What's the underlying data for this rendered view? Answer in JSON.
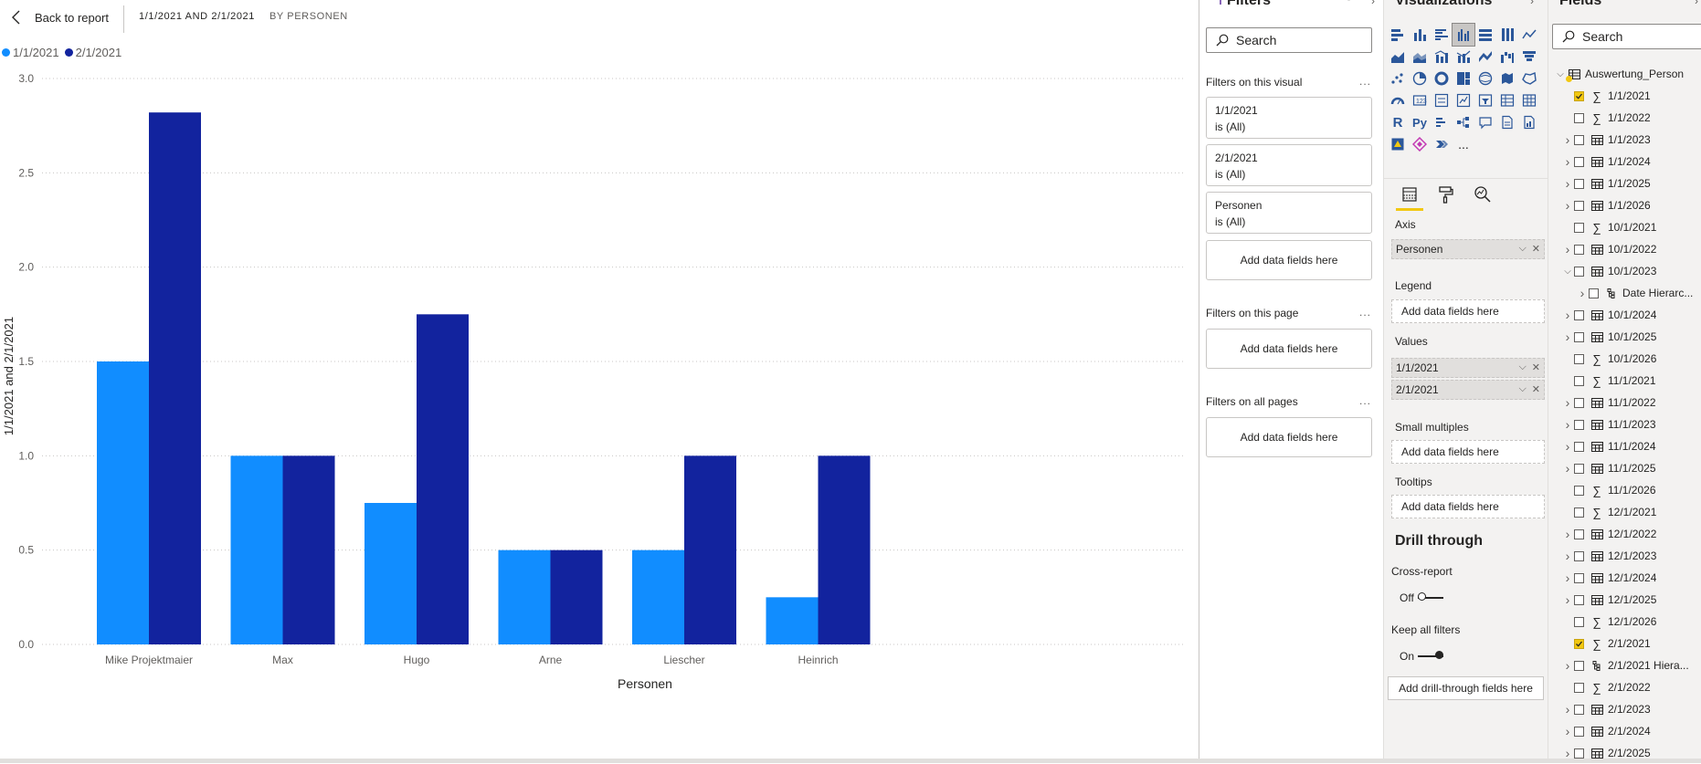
{
  "topbar": {
    "back_label": "Back to report",
    "title": "1/1/2021 AND 2/1/2021",
    "subtitle": "BY PERSONEN"
  },
  "colors": {
    "series_1": "#118dff",
    "series_2": "#12239e",
    "accent": "#f2c811",
    "grid": "#c8c6c4"
  },
  "chart_data": {
    "type": "bar",
    "categories": [
      "Mike Projektmaier",
      "Max",
      "Hugo",
      "Arne",
      "Liescher",
      "Heinrich"
    ],
    "series": [
      {
        "name": "1/1/2021",
        "values": [
          1.5,
          1.0,
          0.75,
          0.5,
          0.5,
          0.25
        ]
      },
      {
        "name": "2/1/2021",
        "values": [
          2.82,
          1.0,
          1.75,
          0.5,
          1.0,
          1.0
        ]
      }
    ],
    "y_ticks": [
      "0.0",
      "0.5",
      "1.0",
      "1.5",
      "2.0",
      "2.5",
      "3.0"
    ],
    "ylim": [
      0,
      3
    ],
    "xlabel": "Personen",
    "ylabel": "1/1/2021 and 2/1/2021",
    "legend_position": "top-left",
    "grid": true
  },
  "filters": {
    "title": "Filters",
    "search_placeholder": "Search",
    "on_visual_label": "Filters on this visual",
    "cards": [
      {
        "field": "1/1/2021",
        "state": "is (All)"
      },
      {
        "field": "2/1/2021",
        "state": "is (All)"
      },
      {
        "field": "Personen",
        "state": "is (All)"
      }
    ],
    "add_label": "Add data fields here",
    "on_page_label": "Filters on this page",
    "on_all_label": "Filters on all pages",
    "more": "..."
  },
  "viz": {
    "title": "Visualizations",
    "more_label": "...",
    "r_label": "R",
    "py_label": "Py",
    "wells": {
      "axis_label": "Axis",
      "axis_field": "Personen",
      "legend_label": "Legend",
      "values_label": "Values",
      "values_fields": [
        "1/1/2021",
        "2/1/2021"
      ],
      "small_multiples_label": "Small multiples",
      "tooltips_label": "Tooltips",
      "add_label": "Add data fields here"
    },
    "drill": {
      "title": "Drill through",
      "cross_report_label": "Cross-report",
      "cross_report_state": "Off",
      "keep_filters_label": "Keep all filters",
      "keep_filters_state": "On",
      "add_label": "Add drill-through fields here"
    }
  },
  "fields": {
    "title": "Fields",
    "search_placeholder": "Search",
    "table_name": "Auswertung_Person",
    "items": [
      {
        "label": "1/1/2021",
        "kind": "sum",
        "checked": true,
        "expandable": false
      },
      {
        "label": "1/1/2022",
        "kind": "sum",
        "checked": false,
        "expandable": false
      },
      {
        "label": "1/1/2023",
        "kind": "table",
        "checked": false,
        "expandable": true
      },
      {
        "label": "1/1/2024",
        "kind": "table",
        "checked": false,
        "expandable": true
      },
      {
        "label": "1/1/2025",
        "kind": "table",
        "checked": false,
        "expandable": true
      },
      {
        "label": "1/1/2026",
        "kind": "table",
        "checked": false,
        "expandable": true
      },
      {
        "label": "10/1/2021",
        "kind": "sum",
        "checked": false,
        "expandable": false
      },
      {
        "label": "10/1/2022",
        "kind": "table",
        "checked": false,
        "expandable": true
      },
      {
        "label": "10/1/2023",
        "kind": "table",
        "checked": false,
        "expandable": true,
        "expanded": true
      },
      {
        "label": "Date Hierarc...",
        "kind": "hier",
        "checked": false,
        "expandable": true,
        "indent": true
      },
      {
        "label": "10/1/2024",
        "kind": "table",
        "checked": false,
        "expandable": true
      },
      {
        "label": "10/1/2025",
        "kind": "table",
        "checked": false,
        "expandable": true
      },
      {
        "label": "10/1/2026",
        "kind": "sum",
        "checked": false,
        "expandable": false
      },
      {
        "label": "11/1/2021",
        "kind": "sum",
        "checked": false,
        "expandable": false
      },
      {
        "label": "11/1/2022",
        "kind": "table",
        "checked": false,
        "expandable": true
      },
      {
        "label": "11/1/2023",
        "kind": "table",
        "checked": false,
        "expandable": true
      },
      {
        "label": "11/1/2024",
        "kind": "table",
        "checked": false,
        "expandable": true
      },
      {
        "label": "11/1/2025",
        "kind": "table",
        "checked": false,
        "expandable": true
      },
      {
        "label": "11/1/2026",
        "kind": "sum",
        "checked": false,
        "expandable": false
      },
      {
        "label": "12/1/2021",
        "kind": "sum",
        "checked": false,
        "expandable": false
      },
      {
        "label": "12/1/2022",
        "kind": "table",
        "checked": false,
        "expandable": true
      },
      {
        "label": "12/1/2023",
        "kind": "table",
        "checked": false,
        "expandable": true
      },
      {
        "label": "12/1/2024",
        "kind": "table",
        "checked": false,
        "expandable": true
      },
      {
        "label": "12/1/2025",
        "kind": "table",
        "checked": false,
        "expandable": true
      },
      {
        "label": "12/1/2026",
        "kind": "sum",
        "checked": false,
        "expandable": false
      },
      {
        "label": "2/1/2021",
        "kind": "sum",
        "checked": true,
        "expandable": false
      },
      {
        "label": "2/1/2021 Hiera...",
        "kind": "hier",
        "checked": false,
        "expandable": true
      },
      {
        "label": "2/1/2022",
        "kind": "sum",
        "checked": false,
        "expandable": false
      },
      {
        "label": "2/1/2023",
        "kind": "table",
        "checked": false,
        "expandable": true
      },
      {
        "label": "2/1/2024",
        "kind": "table",
        "checked": false,
        "expandable": true
      },
      {
        "label": "2/1/2025",
        "kind": "table",
        "checked": false,
        "expandable": true
      }
    ]
  }
}
